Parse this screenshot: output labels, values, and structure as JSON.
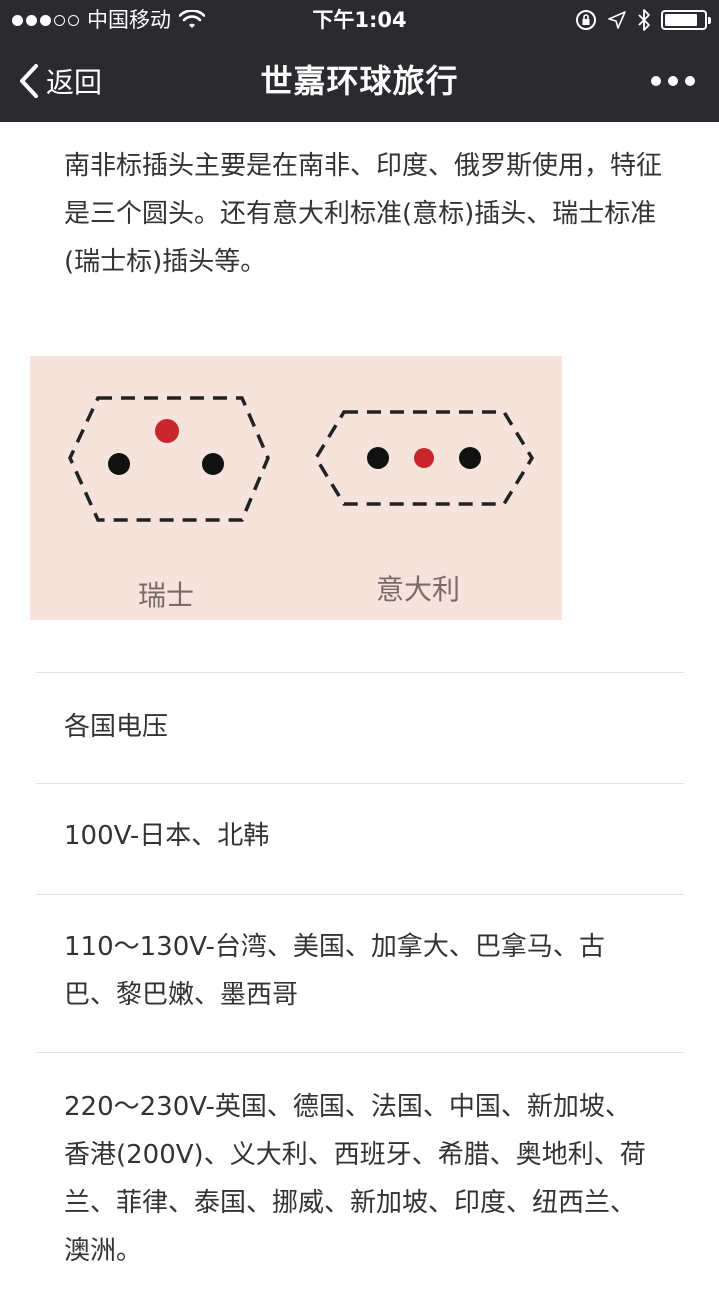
{
  "status_bar": {
    "carrier": "中国移动",
    "time": "下午1:04",
    "battery_level": 0.85
  },
  "nav": {
    "back_label": "返回",
    "title": "世嘉环球旅行"
  },
  "article": {
    "intro": "南非标插头主要是在南非、印度、俄罗斯使用，特征是三个圆头。还有意大利标准(意标)插头、瑞士标准(瑞士标)插头等。",
    "figure": {
      "left_label": "瑞士",
      "right_label": "意大利"
    },
    "rows": [
      "各国电压",
      "100V-日本、北韩",
      "110～130V-台湾、美国、加拿大、巴拿马、古巴、黎巴嫩、墨西哥",
      "220～230V-英国、德国、法国、中国、新加坡、香港(200V)、义大利、西班牙、希腊、奥地利、荷兰、菲律、泰国、挪威、新加坡、印度、纽西兰、澳洲。"
    ]
  },
  "colors": {
    "nav_bg": "#2b2a2f",
    "figure_bg": "#f6e4dc",
    "pin_black": "#111111",
    "pin_red": "#c8262c"
  }
}
